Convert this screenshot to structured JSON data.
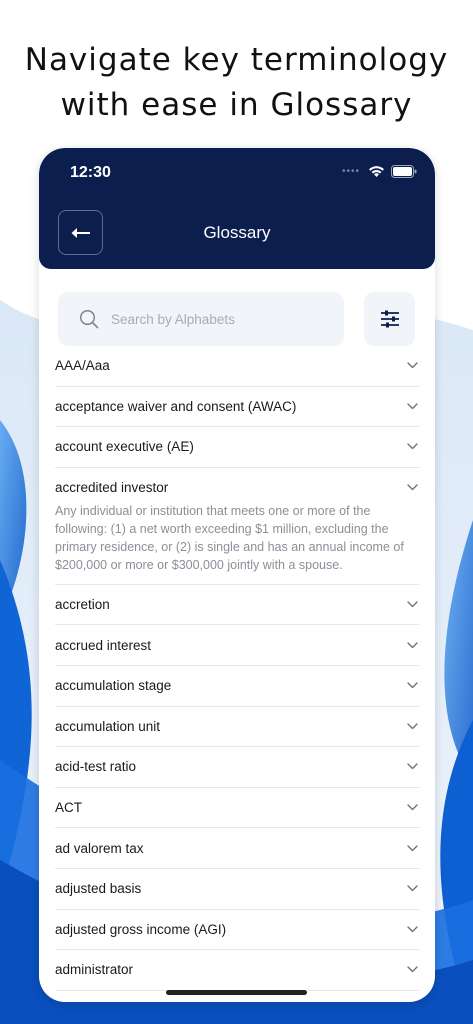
{
  "headline": {
    "line1": "Navigate key terminology",
    "line2": "with ease in Glossary"
  },
  "status_bar": {
    "time": "12:30",
    "signal_icon": "signal-dots-icon",
    "wifi_icon": "wifi-icon",
    "battery_icon": "battery-icon"
  },
  "header": {
    "title": "Glossary",
    "back_icon": "back-arrow-icon"
  },
  "search": {
    "placeholder": "Search by Alphabets",
    "icon": "search-icon"
  },
  "filter": {
    "icon": "filter-sliders-icon"
  },
  "glossary": {
    "items": [
      {
        "term": "AAA/Aaa"
      },
      {
        "term": "acceptance waiver and consent (AWAC)"
      },
      {
        "term": "account executive (AE)"
      },
      {
        "term": "accredited investor",
        "definition": "Any individual or institution that meets one or more of the following: (1) a net worth exceeding $1 million, excluding the primary residence, or (2) is single and has an annual income of $200,000 or more or $300,000 jointly with a spouse."
      },
      {
        "term": "accretion"
      },
      {
        "term": "accrued interest"
      },
      {
        "term": "accumulation stage"
      },
      {
        "term": "accumulation unit"
      },
      {
        "term": "acid-test ratio"
      },
      {
        "term": "ACT"
      },
      {
        "term": "ad valorem tax"
      },
      {
        "term": "adjusted basis"
      },
      {
        "term": "adjusted gross income (AGI)"
      },
      {
        "term": "administrator"
      }
    ]
  },
  "colors": {
    "appbar": "#0b1e4d",
    "wave_blue": "#1e73d8",
    "search_bg": "#f1f4f9"
  }
}
